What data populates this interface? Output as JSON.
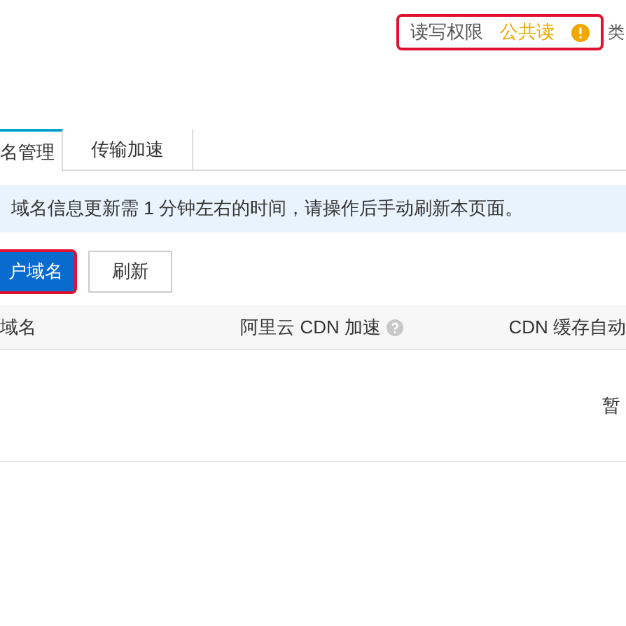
{
  "permission": {
    "label": "读写权限",
    "value": "公共读",
    "trailing": "类"
  },
  "tabs": [
    {
      "label": "名管理",
      "selected": true
    },
    {
      "label": "传输加速",
      "selected": false
    }
  ],
  "notice": "域名信息更新需 1 分钟左右的时间，请操作后手动刷新本页面。",
  "buttons": [
    {
      "label": "户域名",
      "kind": "primary"
    },
    {
      "label": "刷新",
      "kind": "default"
    }
  ],
  "table": {
    "columns": [
      {
        "label": "域名",
        "help": false
      },
      {
        "label": "阿里云 CDN 加速",
        "help": true
      },
      {
        "label": "CDN 缓存自动",
        "help": false
      }
    ],
    "empty": "暂"
  }
}
